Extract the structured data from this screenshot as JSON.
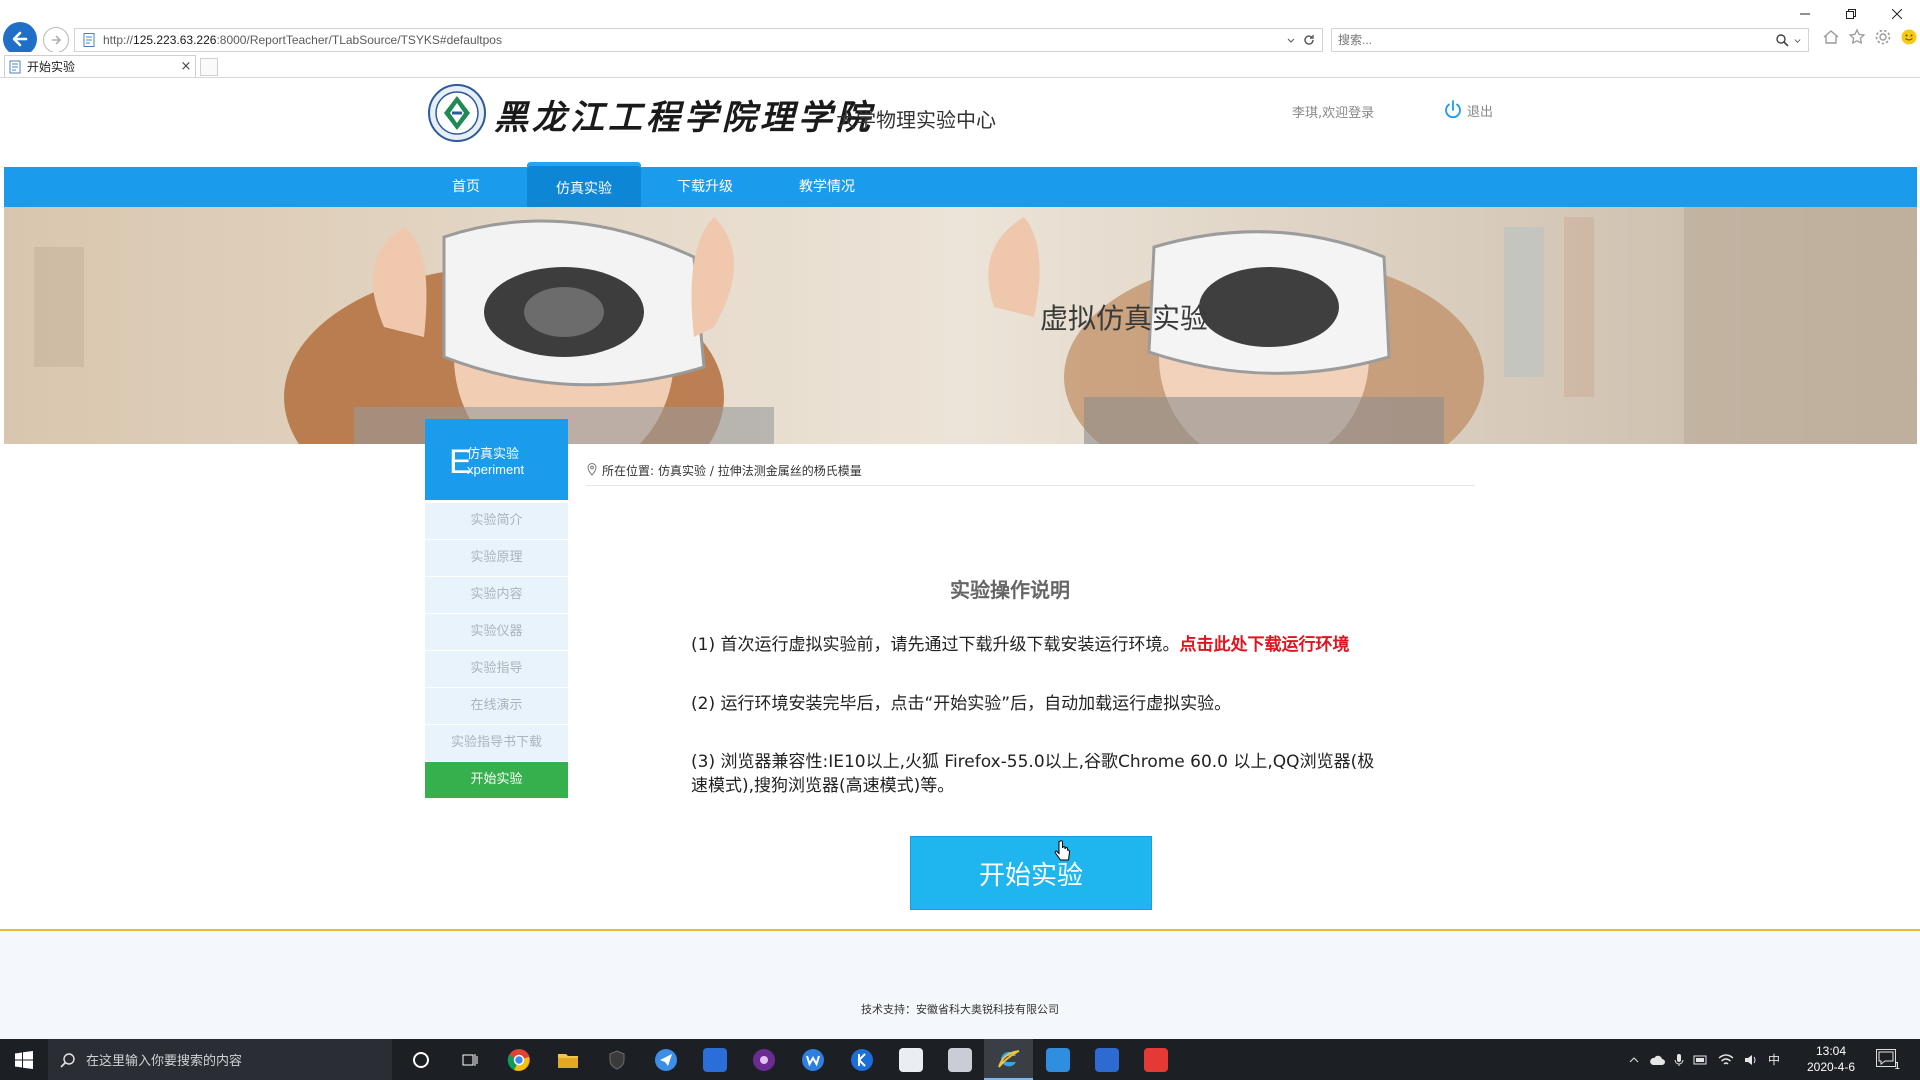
{
  "browser": {
    "url_prefix": "http://",
    "url_host": "125.223.63.226",
    "url_rest": ":8000/ReportTeacher/TLabSource/TSYKS#defaultpos",
    "search_placeholder": "搜索...",
    "tab_title": "开始实验",
    "tab_close": "×"
  },
  "header": {
    "school_name": "黑龙江工程学院理学院",
    "center_name": "大学物理实验中心",
    "welcome": "李琪,欢迎登录",
    "logout": "退出"
  },
  "nav": {
    "items": [
      "首页",
      "仿真实验",
      "下载升级",
      "教学情况"
    ],
    "active_index": 1
  },
  "banner": {
    "title": "虚拟仿真实验"
  },
  "sidebar": {
    "head_letter": "E",
    "head_title": "仿真实验",
    "head_sub": "xperiment",
    "items": [
      "实验简介",
      "实验原理",
      "实验内容",
      "实验仪器",
      "实验指导",
      "在线演示",
      "实验指导书下载",
      "开始实验"
    ],
    "active_index": 7
  },
  "breadcrumb": {
    "label": "所在位置:",
    "path": "仿真实验 / 拉伸法测金属丝的杨氏模量"
  },
  "content": {
    "title": "实验操作说明",
    "p1": "(1) 首次运行虚拟实验前，请先通过下载升级下载安装运行环境。",
    "p1_link": "点击此处下载运行环境",
    "p2": "(2) 运行环境安装完毕后，点击“开始实验”后，自动加载运行虚拟实验。",
    "p3": "(3) 浏览器兼容性:IE10以上,火狐 Firefox-55.0以上,谷歌Chrome 60.0 以上,QQ浏览器(极速模式),搜狗浏览器(高速模式)等。",
    "start_button": "开始实验"
  },
  "footer": {
    "text": "技术支持：安徽省科大奥锐科技有限公司"
  },
  "taskbar": {
    "search_placeholder": "在这里输入你要搜索的内容",
    "time": "13:04",
    "date": "2020-4-6",
    "ime": "中",
    "notification_count": "1"
  },
  "colors": {
    "nav_blue": "#1a9bec",
    "sidebar_active_green": "#35b04c",
    "link_red": "#e0141e",
    "button_cyan": "#1fb5ef",
    "footer_line": "#f2b441"
  }
}
